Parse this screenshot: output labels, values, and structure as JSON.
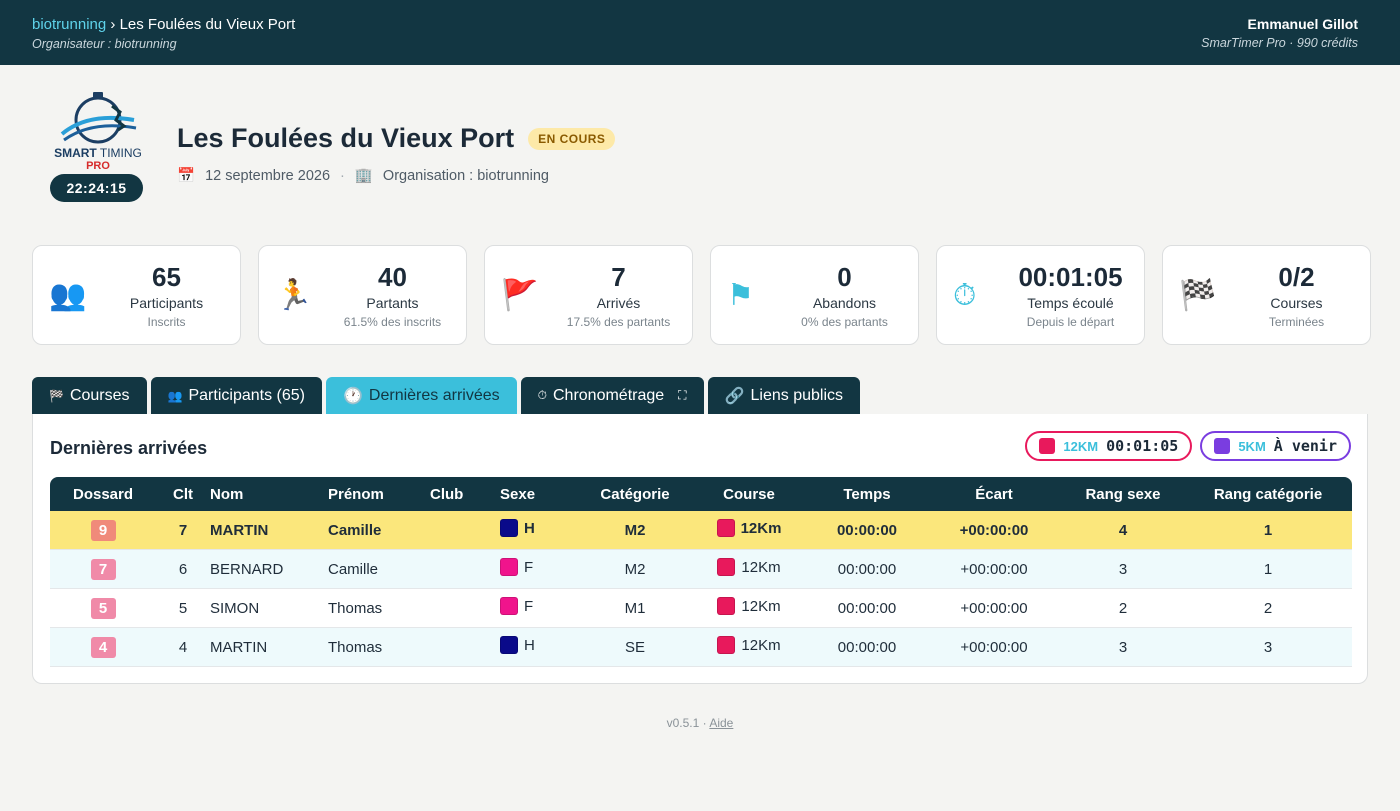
{
  "topbar": {
    "crumb_link": "biotrunning",
    "crumb_sep": " › ",
    "crumb_current": "Les Foulées du Vieux Port",
    "organizer": "Organisateur : biotrunning",
    "user_name": "Emmanuel Gillot",
    "user_plan": "SmarTimer Pro · 990 crédits"
  },
  "logo": {
    "line1": "SMART",
    "line2": "TIMING",
    "line3": "PRO"
  },
  "clock": "22:24:15",
  "event": {
    "title": "Les Foulées du Vieux Port",
    "status": "EN COURS",
    "date_icon": "📅",
    "date": "12 septembre 2026",
    "sep": "·",
    "org_icon": "🏢",
    "organisation": "Organisation : biotrunning"
  },
  "stats": [
    {
      "icon": "👥",
      "icon_name": "participants-icon",
      "value": "65",
      "label": "Participants",
      "hint": "Inscrits"
    },
    {
      "icon": "🏃",
      "icon_name": "runner-icon",
      "value": "40",
      "label": "Partants",
      "hint": "61.5% des inscrits"
    },
    {
      "icon": "🚩",
      "icon_name": "red-flag-icon",
      "value": "7",
      "label": "Arrivés",
      "hint": "17.5% des partants"
    },
    {
      "icon": "⚑",
      "icon_name": "blue-flag-icon",
      "value": "0",
      "label": "Abandons",
      "hint": "0% des partants"
    },
    {
      "icon": "⏱",
      "icon_name": "stopwatch-icon",
      "value": "00:01:05",
      "label": "Temps écoulé",
      "hint": "Depuis le départ"
    },
    {
      "icon": "🏁",
      "icon_name": "checkered-flag-icon",
      "value": "0/2",
      "label": "Courses",
      "hint": "Terminées"
    }
  ],
  "tabs": [
    {
      "icon": "🏁",
      "label": "Courses"
    },
    {
      "icon": "👥",
      "label": "Participants (65)"
    },
    {
      "icon": "🕐",
      "label": "Dernières arrivées"
    },
    {
      "icon": "⏱",
      "label": "Chronométrage",
      "extra": "⛶"
    },
    {
      "icon": "🔗",
      "label": "Liens publics"
    }
  ],
  "panel": {
    "title": "Dernières arrivées",
    "chips": [
      {
        "name": "12KM",
        "time": "00:01:05",
        "color": "#e8195c"
      },
      {
        "name": "5KM",
        "time": "À venir",
        "color": "#7a3de0"
      }
    ]
  },
  "table": {
    "headers": [
      "Dossard",
      "Clt",
      "Nom",
      "Prénom",
      "Club",
      "Sexe",
      "Catégorie",
      "Course",
      "Temps",
      "Écart",
      "Rang sexe",
      "Rang catégorie"
    ],
    "rows": [
      {
        "bib": "9",
        "bib_color": "#f08a7a",
        "clt": "7",
        "nom": "MARTIN",
        "prenom": "Camille",
        "club": "",
        "sexe": "H",
        "sexe_color": "#0a0a8a",
        "cat": "M2",
        "course": "12Km",
        "course_color": "#e8195c",
        "temps": "00:00:00",
        "ecart": "+00:00:00",
        "rang_sexe": "4",
        "rang_cat": "1"
      },
      {
        "bib": "7",
        "bib_color": "#f08aa8",
        "clt": "6",
        "nom": "BERNARD",
        "prenom": "Camille",
        "club": "",
        "sexe": "F",
        "sexe_color": "#f0148c",
        "cat": "M2",
        "course": "12Km",
        "course_color": "#e8195c",
        "temps": "00:00:00",
        "ecart": "+00:00:00",
        "rang_sexe": "3",
        "rang_cat": "1"
      },
      {
        "bib": "5",
        "bib_color": "#f08aa8",
        "clt": "5",
        "nom": "SIMON",
        "prenom": "Thomas",
        "club": "",
        "sexe": "F",
        "sexe_color": "#f0148c",
        "cat": "M1",
        "course": "12Km",
        "course_color": "#e8195c",
        "temps": "00:00:00",
        "ecart": "+00:00:00",
        "rang_sexe": "2",
        "rang_cat": "2"
      },
      {
        "bib": "4",
        "bib_color": "#f08aa8",
        "clt": "4",
        "nom": "MARTIN",
        "prenom": "Thomas",
        "club": "",
        "sexe": "H",
        "sexe_color": "#0a0a8a",
        "cat": "SE",
        "course": "12Km",
        "course_color": "#e8195c",
        "temps": "00:00:00",
        "ecart": "+00:00:00",
        "rang_sexe": "3",
        "rang_cat": "3"
      }
    ]
  },
  "footer": {
    "version": "v0.5.1 · ",
    "help": "Aide"
  }
}
